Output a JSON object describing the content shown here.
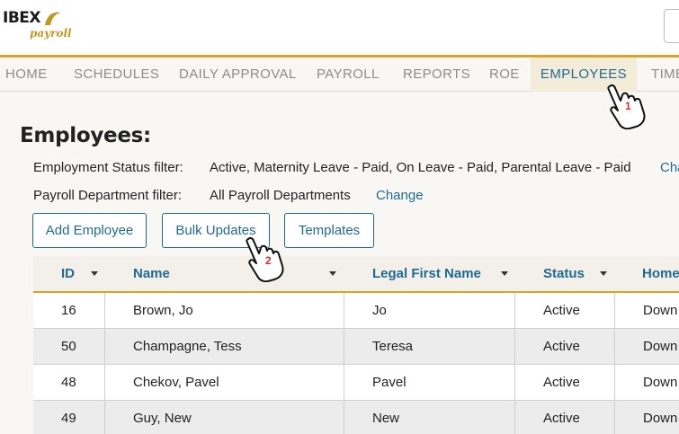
{
  "header": {
    "logo_text": "IBEX",
    "logo_sub": "payroll"
  },
  "nav": {
    "items": [
      "HOME",
      "SCHEDULES",
      "DAILY APPROVAL",
      "PAYROLL",
      "REPORTS",
      "ROE",
      "EMPLOYEES",
      "TIME"
    ],
    "active": "EMPLOYEES"
  },
  "page": {
    "title": "Employees:",
    "status_filter_label": "Employment Status filter:",
    "status_filter_value": "Active, Maternity Leave - Paid, On Leave - Paid, Parental Leave - Paid",
    "status_filter_change": "Cha",
    "dept_filter_label": "Payroll Department filter:",
    "dept_filter_value": "All Payroll Departments",
    "dept_filter_change": "Change"
  },
  "buttons": {
    "add_employee": "Add Employee",
    "bulk_updates": "Bulk Updates",
    "templates": "Templates"
  },
  "table": {
    "columns": [
      "ID",
      "Name",
      "Legal First Name",
      "Status",
      "Home"
    ],
    "rows": [
      {
        "id": "16",
        "name": "Brown, Jo",
        "legal_first": "Jo",
        "status": "Active",
        "home": "Down"
      },
      {
        "id": "50",
        "name": "Champagne, Tess",
        "legal_first": "Teresa",
        "status": "Active",
        "home": "Down"
      },
      {
        "id": "48",
        "name": "Chekov, Pavel",
        "legal_first": "Pavel",
        "status": "Active",
        "home": "Down"
      },
      {
        "id": "49",
        "name": "Guy, New",
        "legal_first": "New",
        "status": "Active",
        "home": "Down"
      }
    ]
  },
  "annotations": {
    "step1": "1",
    "step2": "2"
  },
  "colors": {
    "accent_gold": "#d6a52a",
    "link_blue": "#1f6a93",
    "step_red": "#d0312d"
  }
}
